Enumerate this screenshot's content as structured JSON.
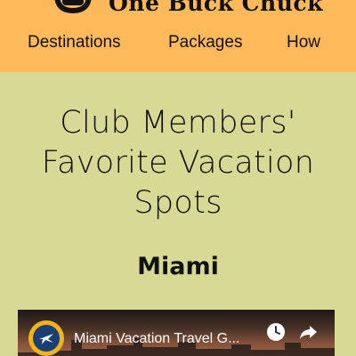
{
  "header": {
    "brand_name": "One Buck Chuck",
    "logo_icon": "handshake-logo-icon",
    "nav": [
      {
        "label": "Destinations"
      },
      {
        "label": "Packages"
      },
      {
        "label": "How"
      }
    ]
  },
  "main": {
    "title": "Club Members' Favorite Vacation Spots",
    "city": "Miami"
  },
  "video": {
    "title": "Miami Vacation Travel G...",
    "channel_icon": "airplane-globe-icon",
    "watch_later_icon": "clock-icon",
    "share_icon": "share-arrow-icon"
  },
  "colors": {
    "header_bg": "#fdb95a",
    "page_bg": "#d8d994",
    "channel_badge": "#f1b417"
  }
}
